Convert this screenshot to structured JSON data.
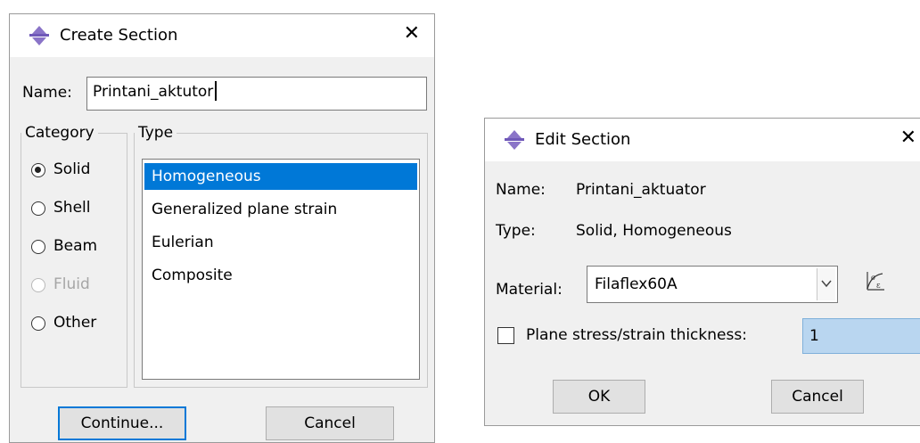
{
  "create": {
    "title": "Create Section",
    "name_label": "Name:",
    "name_value": "Printani_aktutor",
    "category_legend": "Category",
    "type_legend": "Type",
    "categories": [
      {
        "label": "Solid",
        "checked": true,
        "disabled": false
      },
      {
        "label": "Shell",
        "checked": false,
        "disabled": false
      },
      {
        "label": "Beam",
        "checked": false,
        "disabled": false
      },
      {
        "label": "Fluid",
        "checked": false,
        "disabled": true
      },
      {
        "label": "Other",
        "checked": false,
        "disabled": false
      }
    ],
    "types": [
      "Homogeneous",
      "Generalized plane strain",
      "Eulerian",
      "Composite"
    ],
    "selected_type": "Homogeneous",
    "continue_label": "Continue...",
    "cancel_label": "Cancel"
  },
  "edit": {
    "title": "Edit Section",
    "name_label": "Name:",
    "name_value": "Printani_aktuator",
    "type_label": "Type:",
    "type_value": "Solid, Homogeneous",
    "material_label": "Material:",
    "material_value": "Filaflex60A",
    "thickness_label": "Plane stress/strain thickness:",
    "thickness_value": "1",
    "thickness_checked": false,
    "ok_label": "OK",
    "cancel_label": "Cancel"
  },
  "icons": {
    "title_icon": "abaqus-section-icon",
    "close_icon": "close-icon",
    "material_manager_icon": "material-manager-icon"
  },
  "colors": {
    "selection": "#0078d7",
    "dialog_bg": "#f0f0f0",
    "highlight_field": "#b9d6f0"
  }
}
